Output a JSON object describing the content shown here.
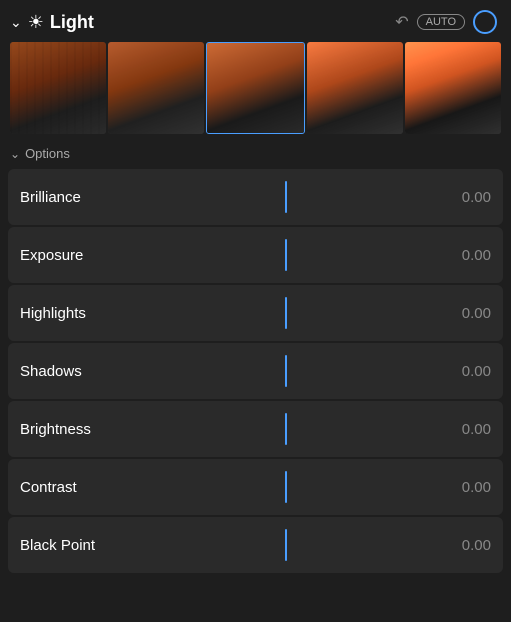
{
  "header": {
    "title": "Light",
    "auto_label": "AUTO",
    "chevron": "⌄",
    "sun_icon": "☀",
    "undo_icon": "↺"
  },
  "options": {
    "label": "Options",
    "chevron": "⌄"
  },
  "sliders": [
    {
      "label": "Brilliance",
      "value": "0.00"
    },
    {
      "label": "Exposure",
      "value": "0.00"
    },
    {
      "label": "Highlights",
      "value": "0.00"
    },
    {
      "label": "Shadows",
      "value": "0.00"
    },
    {
      "label": "Brightness",
      "value": "0.00"
    },
    {
      "label": "Contrast",
      "value": "0.00"
    },
    {
      "label": "Black Point",
      "value": "0.00"
    }
  ],
  "colors": {
    "accent": "#4a9eff",
    "background": "#1e1e1e",
    "row_bg": "#2a2a2a",
    "text_primary": "#ffffff",
    "text_secondary": "#888888",
    "text_muted": "#aaaaaa"
  }
}
